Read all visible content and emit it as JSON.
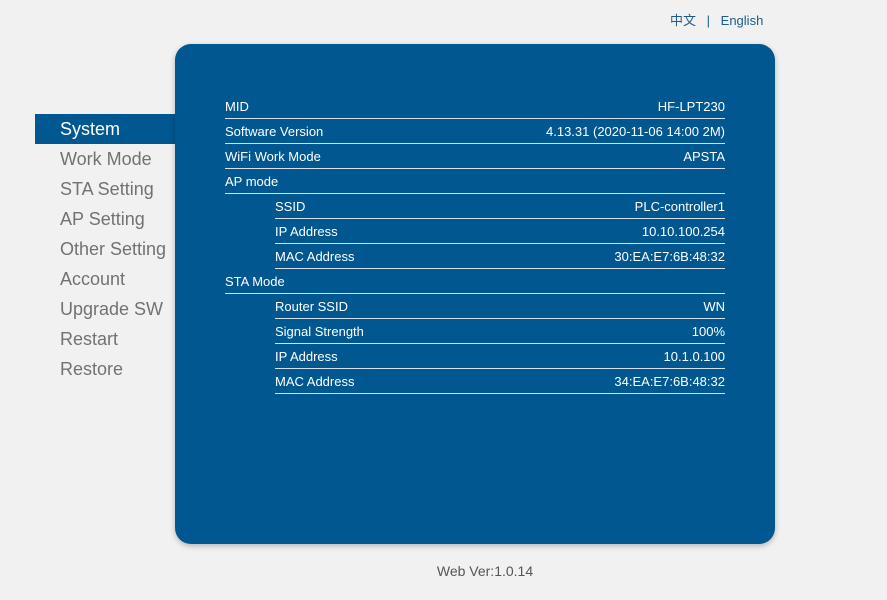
{
  "language": {
    "chinese": "中文",
    "separator": "|",
    "english": "English"
  },
  "sidebar": {
    "items": [
      {
        "label": "System",
        "active": true
      },
      {
        "label": "Work Mode"
      },
      {
        "label": "STA Setting"
      },
      {
        "label": "AP Setting"
      },
      {
        "label": "Other Setting"
      },
      {
        "label": "Account"
      },
      {
        "label": "Upgrade SW"
      },
      {
        "label": "Restart"
      },
      {
        "label": "Restore"
      }
    ]
  },
  "system": {
    "mid_label": "MID",
    "mid_value": "HF-LPT230",
    "software_version_label": "Software Version",
    "software_version_value": "4.13.31 (2020-11-06 14:00 2M)",
    "wifi_work_mode_label": "WiFi Work Mode",
    "wifi_work_mode_value": "APSTA",
    "ap_mode_label": "AP mode",
    "ap": {
      "ssid_label": "SSID",
      "ssid_value": "PLC-controller1",
      "ip_label": "IP Address",
      "ip_value": "10.10.100.254",
      "mac_label": "MAC Address",
      "mac_value": "30:EA:E7:6B:48:32"
    },
    "sta_mode_label": "STA Mode",
    "sta": {
      "router_ssid_label": "Router SSID",
      "router_ssid_value": "WN",
      "signal_label": "Signal Strength",
      "signal_value": "100%",
      "ip_label": "IP Address",
      "ip_value": "10.1.0.100",
      "mac_label": "MAC Address",
      "mac_value": "34:EA:E7:6B:48:32"
    }
  },
  "footer": {
    "web_version": "Web Ver:1.0.14"
  },
  "colors": {
    "panel_bg": "#015891",
    "page_bg": "#f2f1f1",
    "link": "#1d5a8e",
    "nav_text": "#727272"
  }
}
